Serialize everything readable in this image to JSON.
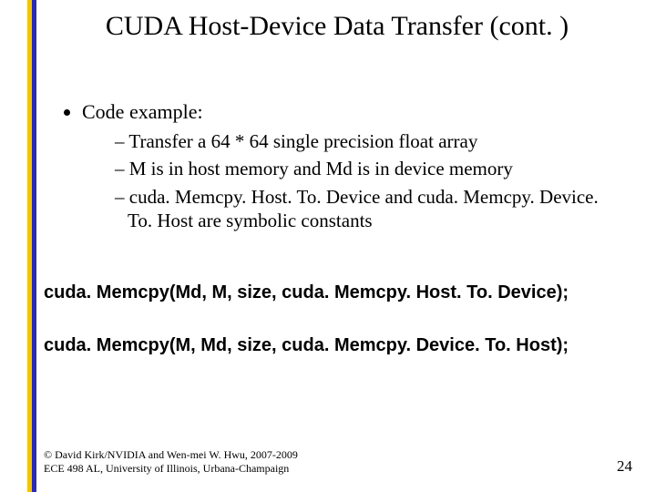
{
  "title": "CUDA Host-Device Data Transfer (cont. )",
  "bullets": [
    {
      "text": "Code example:",
      "sub": [
        "Transfer a  64 * 64 single precision float array",
        "M is in host memory and Md is in device memory",
        "cuda. Memcpy. Host. To. Device and cuda. Memcpy. Device. To. Host are symbolic constants"
      ]
    }
  ],
  "code": [
    "cuda. Memcpy(Md, M, size, cuda. Memcpy. Host. To. Device);",
    "cuda. Memcpy(M, Md, size, cuda. Memcpy. Device. To. Host);"
  ],
  "footer": {
    "line1": "© David Kirk/NVIDIA and Wen-mei W. Hwu, 2007-2009",
    "line2": "ECE 498 AL, University of Illinois, Urbana-Champaign"
  },
  "page_number": "24"
}
